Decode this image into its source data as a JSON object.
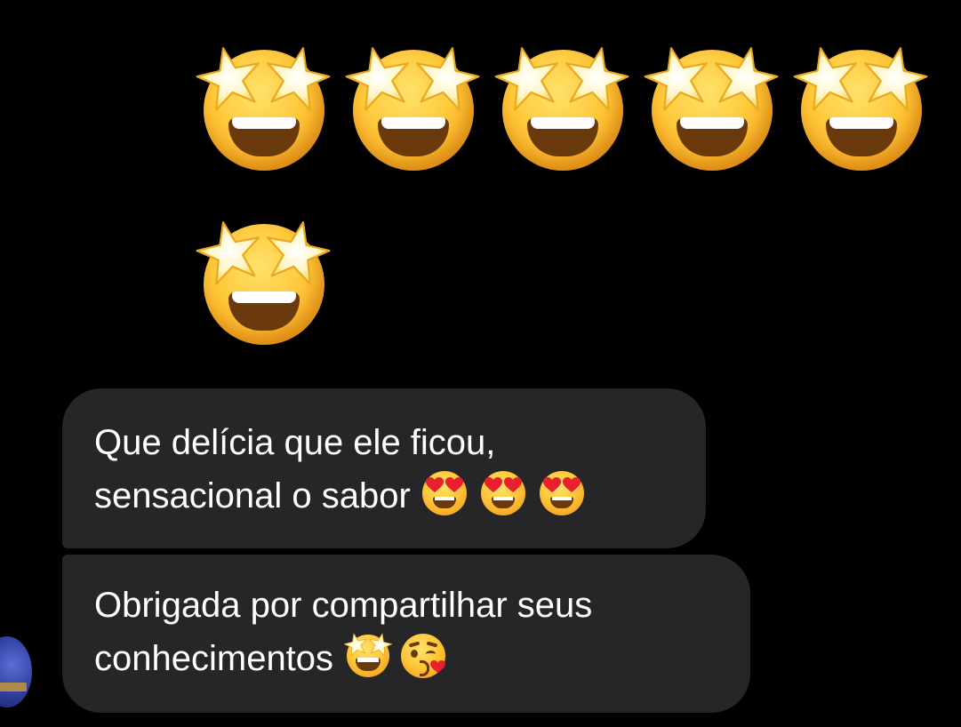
{
  "big_emoji_message": {
    "rows": [
      [
        "star-struck",
        "star-struck",
        "star-struck",
        "star-struck",
        "star-struck"
      ],
      [
        "star-struck"
      ]
    ]
  },
  "messages": [
    {
      "lines": [
        "Que delícia que ele ficou,",
        "sensacional o sabor"
      ],
      "trailing_emojis": [
        "smiling-face-with-heart-eyes",
        "smiling-face-with-heart-eyes",
        "smiling-face-with-heart-eyes"
      ]
    },
    {
      "lines": [
        "Obrigada por compartilhar seus",
        "conhecimentos"
      ],
      "trailing_emojis": [
        "star-struck",
        "face-blowing-a-kiss"
      ]
    }
  ],
  "colors": {
    "background": "#000000",
    "bubble": "#262628",
    "text": "#ffffff"
  }
}
